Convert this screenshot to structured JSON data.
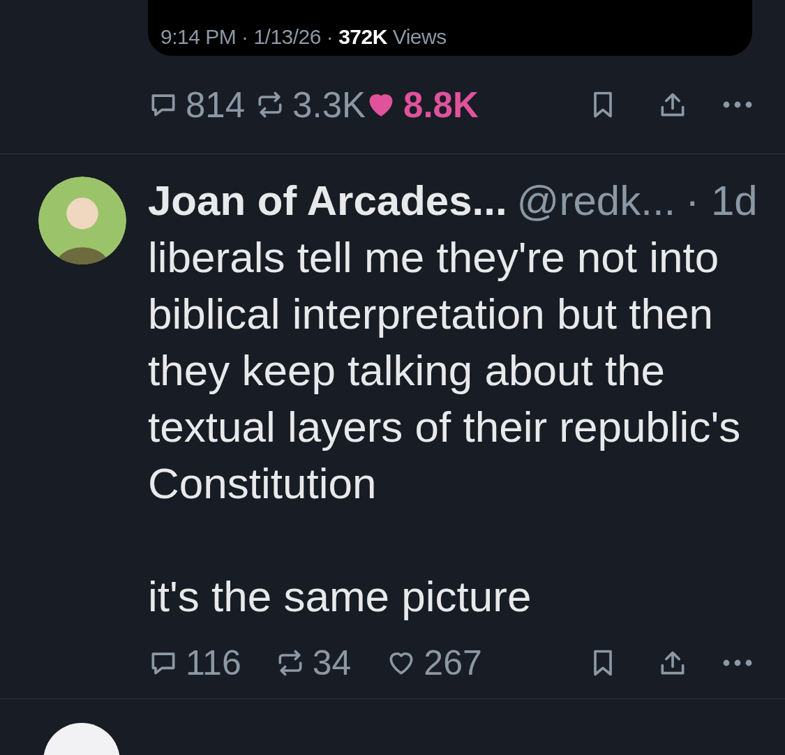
{
  "main_post": {
    "meta": "9:14 PM · 1/13/26 · **372K** Views",
    "actions": {
      "replies": "814",
      "reposts": "3.3K",
      "likes": "8.8K",
      "liked": true
    }
  },
  "reply": {
    "name": "Joan of Arcades...",
    "handle": "@redk...",
    "age": "· 1d",
    "text": "liberals tell me they're not into biblical interpretation but then they keep talking about the textual layers of their republic's Constitution\n\nit's the same picture",
    "actions": {
      "replies": "116",
      "reposts": "34",
      "likes": "267",
      "liked": false
    }
  }
}
